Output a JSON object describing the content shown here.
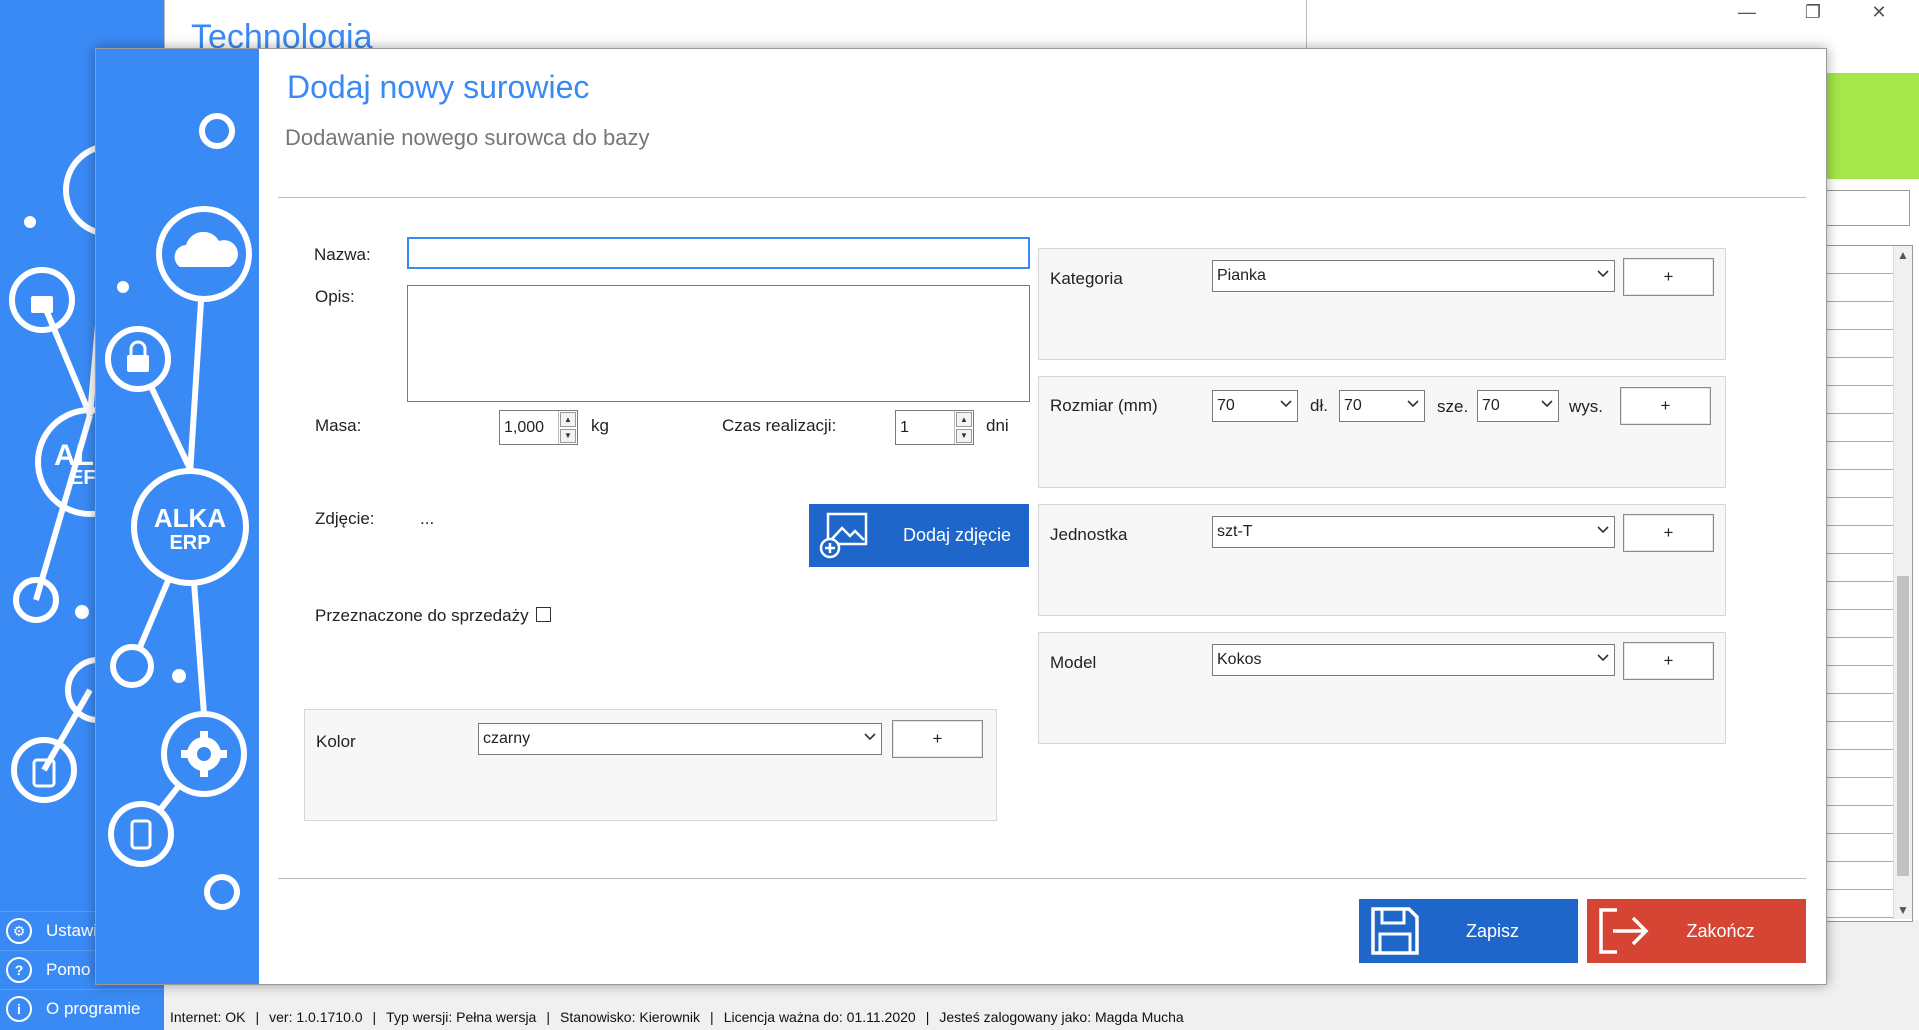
{
  "background": {
    "window_title": "Technologia",
    "menu": [
      {
        "icon": "gear-icon",
        "label": "Ustawi"
      },
      {
        "icon": "help-icon",
        "label": "Pomo"
      },
      {
        "icon": "info-icon",
        "label": "O programie"
      }
    ],
    "logo": {
      "line1": "AL",
      "line2": "EF"
    }
  },
  "window_controls": {
    "minimize": "—",
    "restore": "❐",
    "close": "✕"
  },
  "dialog": {
    "logo": {
      "line1": "ALKA",
      "line2": "ERP"
    },
    "title": "Dodaj nowy surowiec",
    "subtitle": "Dodawanie nowego surowca do bazy",
    "form": {
      "name_label": "Nazwa:",
      "name_value": "",
      "description_label": "Opis:",
      "description_value": "",
      "mass_label": "Masa:",
      "mass_value": "1,000",
      "mass_unit": "kg",
      "lead_time_label": "Czas realizacji:",
      "lead_time_value": "1",
      "lead_time_unit": "dni",
      "photo_label": "Zdjęcie:",
      "photo_value": "...",
      "add_photo_button": "Dodaj zdjęcie",
      "for_sale_label": "Przeznaczone do sprzedaży",
      "for_sale_checked": false,
      "color_label": "Kolor",
      "color_value": "czarny"
    },
    "right_panel": {
      "category_label": "Kategoria",
      "category_value": "Pianka",
      "size_label": "Rozmiar (mm)",
      "size_length": "70",
      "size_length_unit": "dł.",
      "size_width": "70",
      "size_width_unit": "sze.",
      "size_height": "70",
      "size_height_unit": "wys.",
      "unit_label": "Jednostka",
      "unit_value": "szt-T",
      "model_label": "Model",
      "model_value": "Kokos",
      "plus": "+"
    },
    "buttons": {
      "save": "Zapisz",
      "close": "Zakończ"
    }
  },
  "status_bar": {
    "internet": "Internet: OK",
    "version": "ver: 1.0.1710.0",
    "version_type": "Typ wersji: Pełna wersja",
    "station": "Stanowisko: Kierownik",
    "license": "Licencja ważna do: 01.11.2020",
    "user": "Jesteś zalogowany jako: Magda Mucha"
  },
  "colors": {
    "accent": "#3a8af5",
    "button_blue": "#1e66c9",
    "button_red": "#d64534",
    "bg_green": "#a6e64a"
  }
}
